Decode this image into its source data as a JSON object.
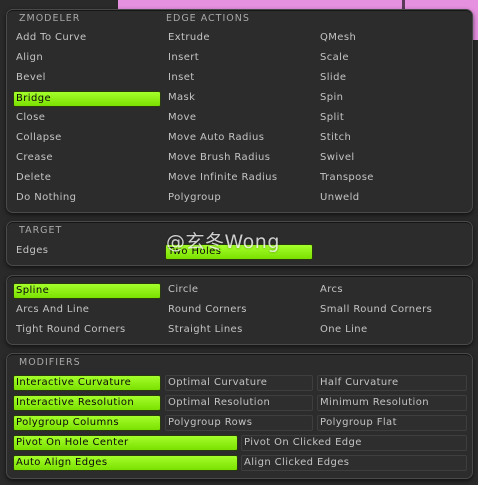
{
  "zmodeler": {
    "title": "ZMODELER",
    "section_title": "EDGE ACTIONS",
    "col1": [
      "Add To Curve",
      "Align",
      "Bevel",
      "Bridge",
      "Close",
      "Collapse",
      "Crease",
      "Delete",
      "Do Nothing"
    ],
    "col2": [
      "Extrude",
      "Insert",
      "Inset",
      "Mask",
      "Move",
      "Move Auto Radius",
      "Move Brush Radius",
      "Move Infinite Radius",
      "Polygroup"
    ],
    "col3": [
      "QMesh",
      "Scale",
      "Slide",
      "Spin",
      "Split",
      "Stitch",
      "Swivel",
      "Transpose",
      "Unweld"
    ],
    "selected": "Bridge"
  },
  "target": {
    "title": "TARGET",
    "items": [
      "Edges",
      "Two Holes"
    ],
    "selected": "Two Holes"
  },
  "curve": {
    "rows": [
      [
        "Spline",
        "Circle",
        "Arcs"
      ],
      [
        "Arcs And Line",
        "Round Corners",
        "Small Round Corners"
      ],
      [
        "Tight Round Corners",
        "Straight Lines",
        "One Line"
      ]
    ],
    "selected": "Spline"
  },
  "modifiers": {
    "title": "MODIFIERS",
    "rows3": [
      [
        "Interactive Curvature",
        "Optimal Curvature",
        "Half Curvature"
      ],
      [
        "Interactive Resolution",
        "Optimal Resolution",
        "Minimum Resolution"
      ],
      [
        "Polygroup Columns",
        "Polygroup Rows",
        "Polygroup Flat"
      ]
    ],
    "rows2": [
      [
        "Pivot On Hole Center",
        "Pivot On Clicked Edge"
      ],
      [
        "Auto Align Edges",
        "Align Clicked Edges"
      ]
    ]
  },
  "watermark": "@玄冬Wong",
  "colors": {
    "selected": "#8cf014",
    "panel": "#2c2c2c",
    "text": "#c4c4c4"
  }
}
